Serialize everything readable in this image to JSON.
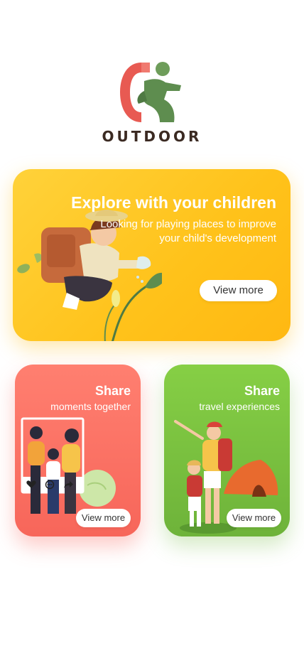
{
  "brand": {
    "name": "OUTDOOR",
    "colors": {
      "red": "#e85a52",
      "green": "#5e8d4f",
      "text": "#3b2a22"
    }
  },
  "hero": {
    "title": "Explore with your children",
    "subtitle": "Looking for playing places to improve your child's development",
    "button_label": "View more",
    "color": "#ffc21a"
  },
  "cards": [
    {
      "title": "Share",
      "subtitle": "moments together",
      "button_label": "View more",
      "color": "#f7665a",
      "icons": [
        "heart-icon",
        "comment-icon",
        "share-icon"
      ]
    },
    {
      "title": "Share",
      "subtitle": "travel experiences",
      "button_label": "View more",
      "color": "#6eb33a"
    }
  ]
}
